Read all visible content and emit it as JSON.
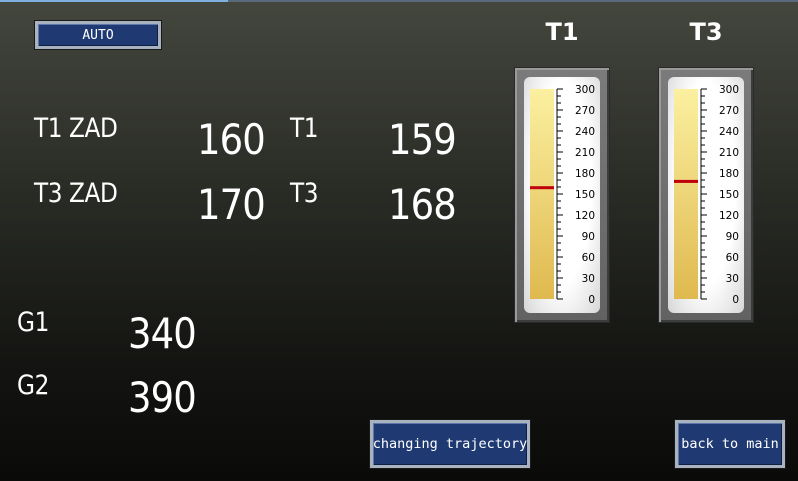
{
  "auto_button": "AUTO",
  "readouts": {
    "t1_zad_label": "T1 ZAD",
    "t1_zad_value": "160",
    "t1_label": "T1",
    "t1_value": "159",
    "t3_zad_label": "T3 ZAD",
    "t3_zad_value": "170",
    "t3_label": "T3",
    "t3_value": "168",
    "g1_label": "G1",
    "g1_value": "340",
    "g2_label": "G2",
    "g2_value": "390"
  },
  "gauges": [
    {
      "title": "T1",
      "value": 159,
      "min": 0,
      "max": 300,
      "ticks": [
        "300",
        "270",
        "240",
        "210",
        "180",
        "150",
        "120",
        "90",
        "60",
        "30",
        "0"
      ]
    },
    {
      "title": "T3",
      "value": 168,
      "min": 0,
      "max": 300,
      "ticks": [
        "300",
        "270",
        "240",
        "210",
        "180",
        "150",
        "120",
        "90",
        "60",
        "30",
        "0"
      ]
    }
  ],
  "buttons": {
    "changing_trajectory": "changing trajectory",
    "back_to_main": "back to main"
  },
  "colors": {
    "button_bg": "#1f3a73",
    "gauge_fill": "#e8c96a",
    "pointer": "#c0000c"
  }
}
